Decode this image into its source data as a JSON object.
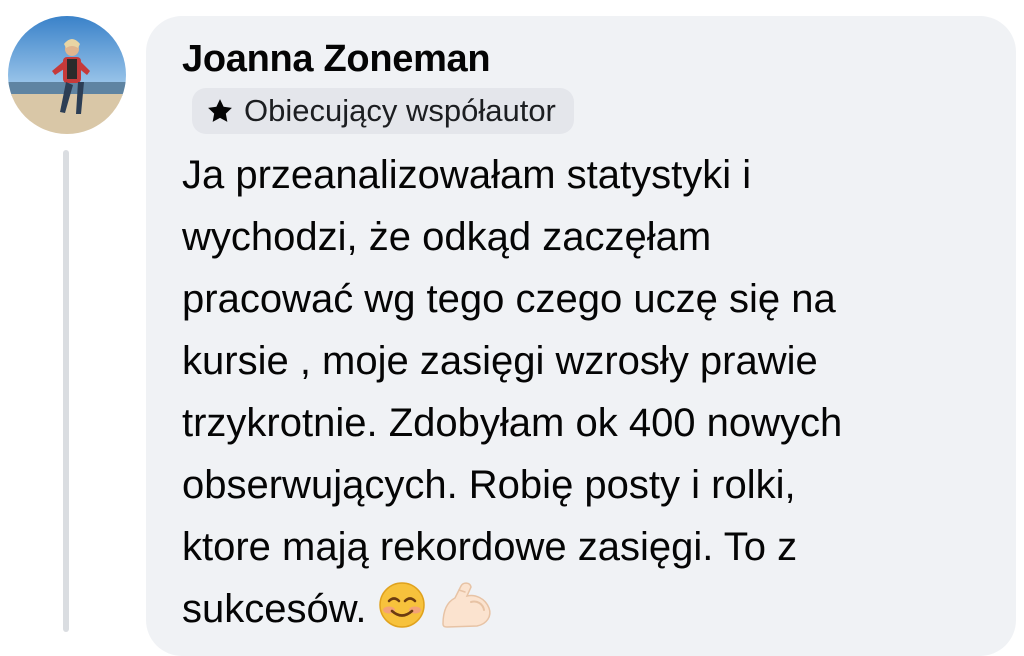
{
  "comment": {
    "author_name": "Joanna Zoneman",
    "badge_label": "Obiecujący współautor",
    "badge_icon": "star-icon",
    "lines": [
      "Ja przeanalizowałam statystyki i",
      "wychodzi, że odkąd zaczęłam",
      "pracować wg tego czego uczę się na",
      "kursie , moje zasięgi wzrosły prawie",
      "trzykrotnie. Zdobyłam ok 400 nowych",
      "obserwujących. Robię posty i rolki,",
      "ktore mają rekordowe zasięgi. To z",
      "sukcesów."
    ],
    "emojis": [
      "smiling-face-emoji",
      "flexed-biceps-emoji"
    ]
  },
  "colors": {
    "bubble_bg": "#f0f2f5",
    "badge_bg": "#e4e6eb",
    "thread_line": "#dadde1",
    "text": "#050505"
  }
}
